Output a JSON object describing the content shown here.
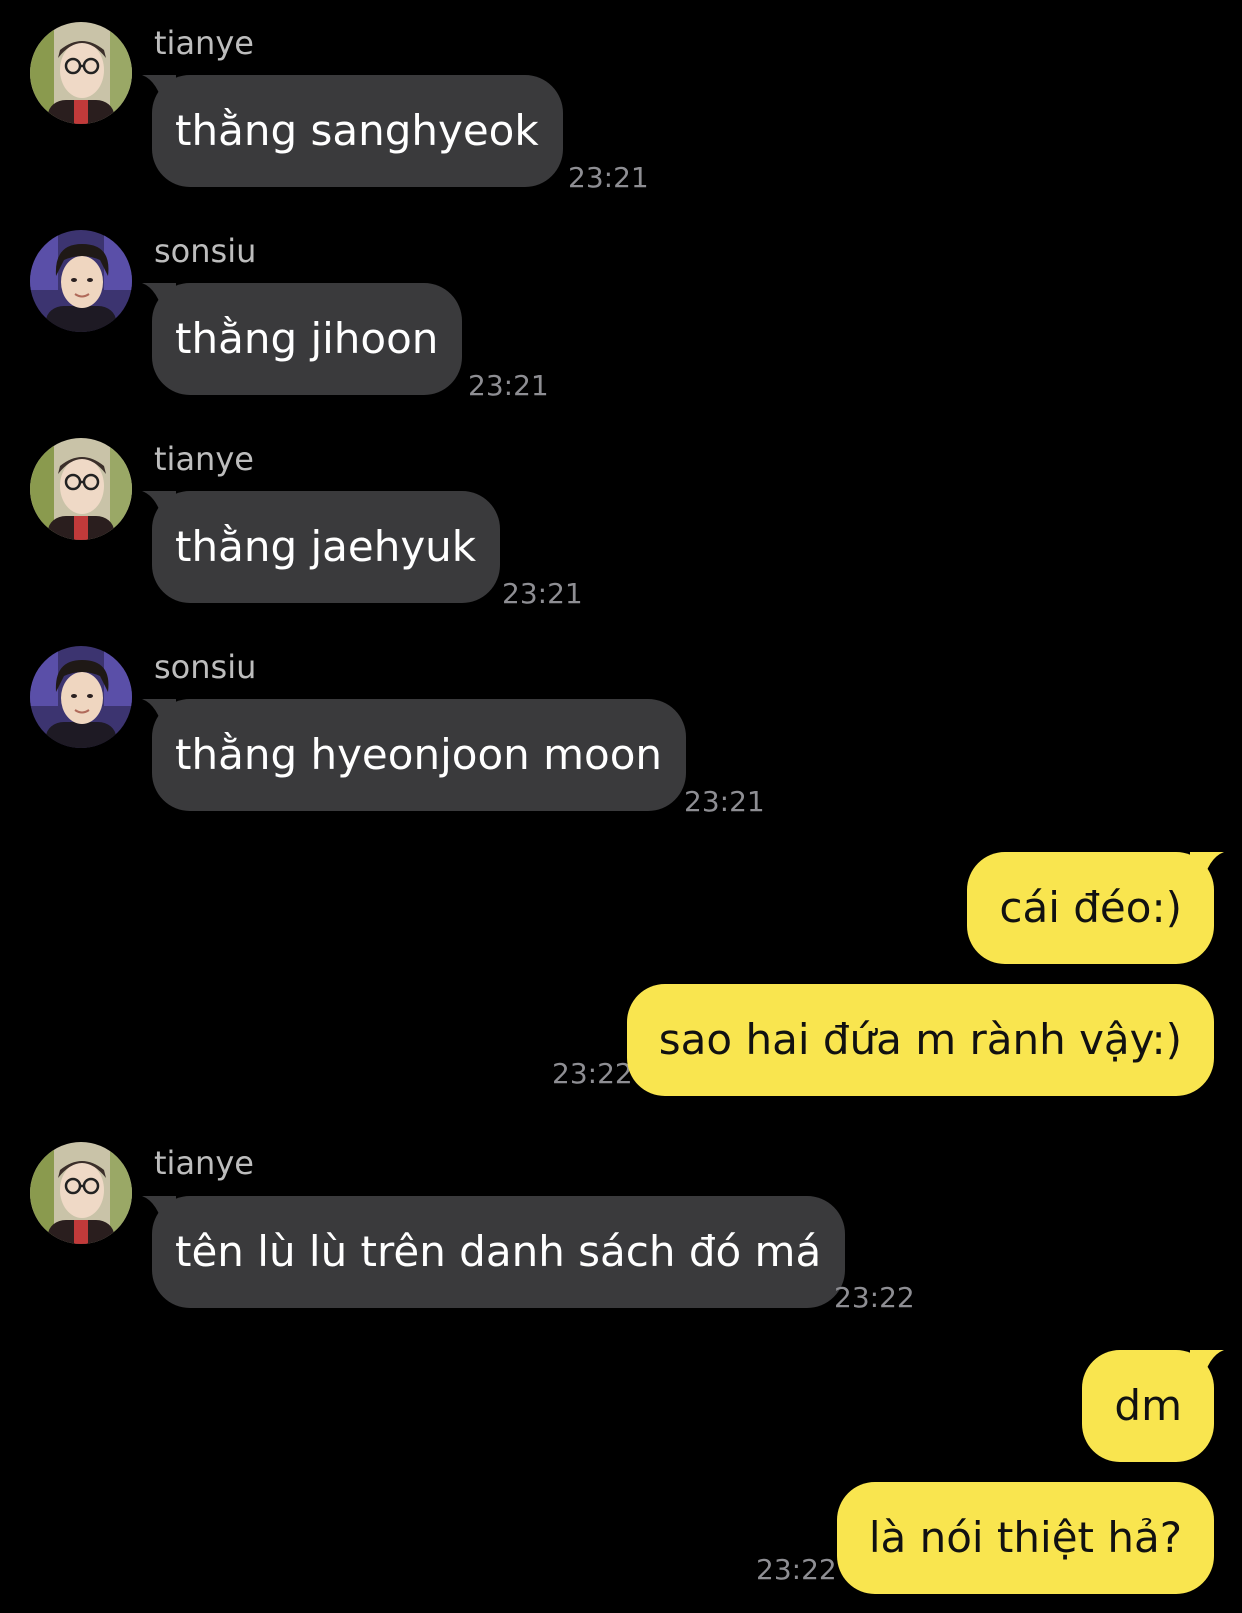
{
  "colors": {
    "background": "#000000",
    "incoming_bubble": "#3a3a3c",
    "outgoing_bubble": "#f9e54f",
    "sender_name": "#bdbdbd",
    "timestamp": "#8e8e93"
  },
  "messages": [
    {
      "direction": "incoming",
      "sender": "tianye",
      "text": "thằng sanghyeok",
      "time": "23:21"
    },
    {
      "direction": "incoming",
      "sender": "sonsiu",
      "text": "thằng jihoon",
      "time": "23:21"
    },
    {
      "direction": "incoming",
      "sender": "tianye",
      "text": "thằng jaehyuk",
      "time": "23:21"
    },
    {
      "direction": "incoming",
      "sender": "sonsiu",
      "text": "thằng hyeonjoon moon",
      "time": "23:21"
    },
    {
      "direction": "outgoing",
      "text": "cái đéo:)"
    },
    {
      "direction": "outgoing",
      "text": "sao hai đứa m rành vậy:)",
      "time": "23:22"
    },
    {
      "direction": "incoming",
      "sender": "tianye",
      "text": "tên lù lù trên danh sách đó má",
      "time": "23:22"
    },
    {
      "direction": "outgoing",
      "text": "dm"
    },
    {
      "direction": "outgoing",
      "text": "là nói thiệt hả?",
      "time": "23:22"
    }
  ]
}
